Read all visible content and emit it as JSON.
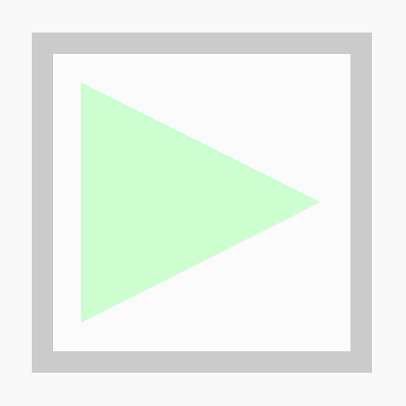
{
  "icon": {
    "name": "play-icon",
    "frame_color": "#cbcbcb",
    "background_color": "#fbfbfc",
    "triangle_color": "#ccfecf"
  }
}
